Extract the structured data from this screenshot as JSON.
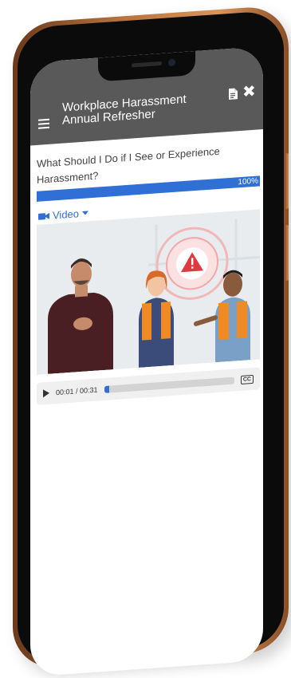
{
  "app": {
    "title": "Workplace Harassment Annual Refresher",
    "menu_icon": "hamburger-menu-icon",
    "document_icon": "document-icon",
    "close_icon": "close-icon",
    "close_glyph": "✖"
  },
  "lesson": {
    "title": "What Should I Do if I See or Experience Harassment?",
    "progress": {
      "value": 100,
      "label": "100%"
    }
  },
  "media": {
    "toggle_label": "Video",
    "toggle_icon": "video-camera-icon",
    "scene": "illustration of presenter and two workers with warning sign"
  },
  "player": {
    "time": "00:01 / 00:31",
    "played_fraction": 0.03,
    "cc_label": "CC"
  },
  "colors": {
    "header": "#595959",
    "accent": "#2f6fd6",
    "warning": "#e0393e",
    "frame": "#b8733e"
  }
}
